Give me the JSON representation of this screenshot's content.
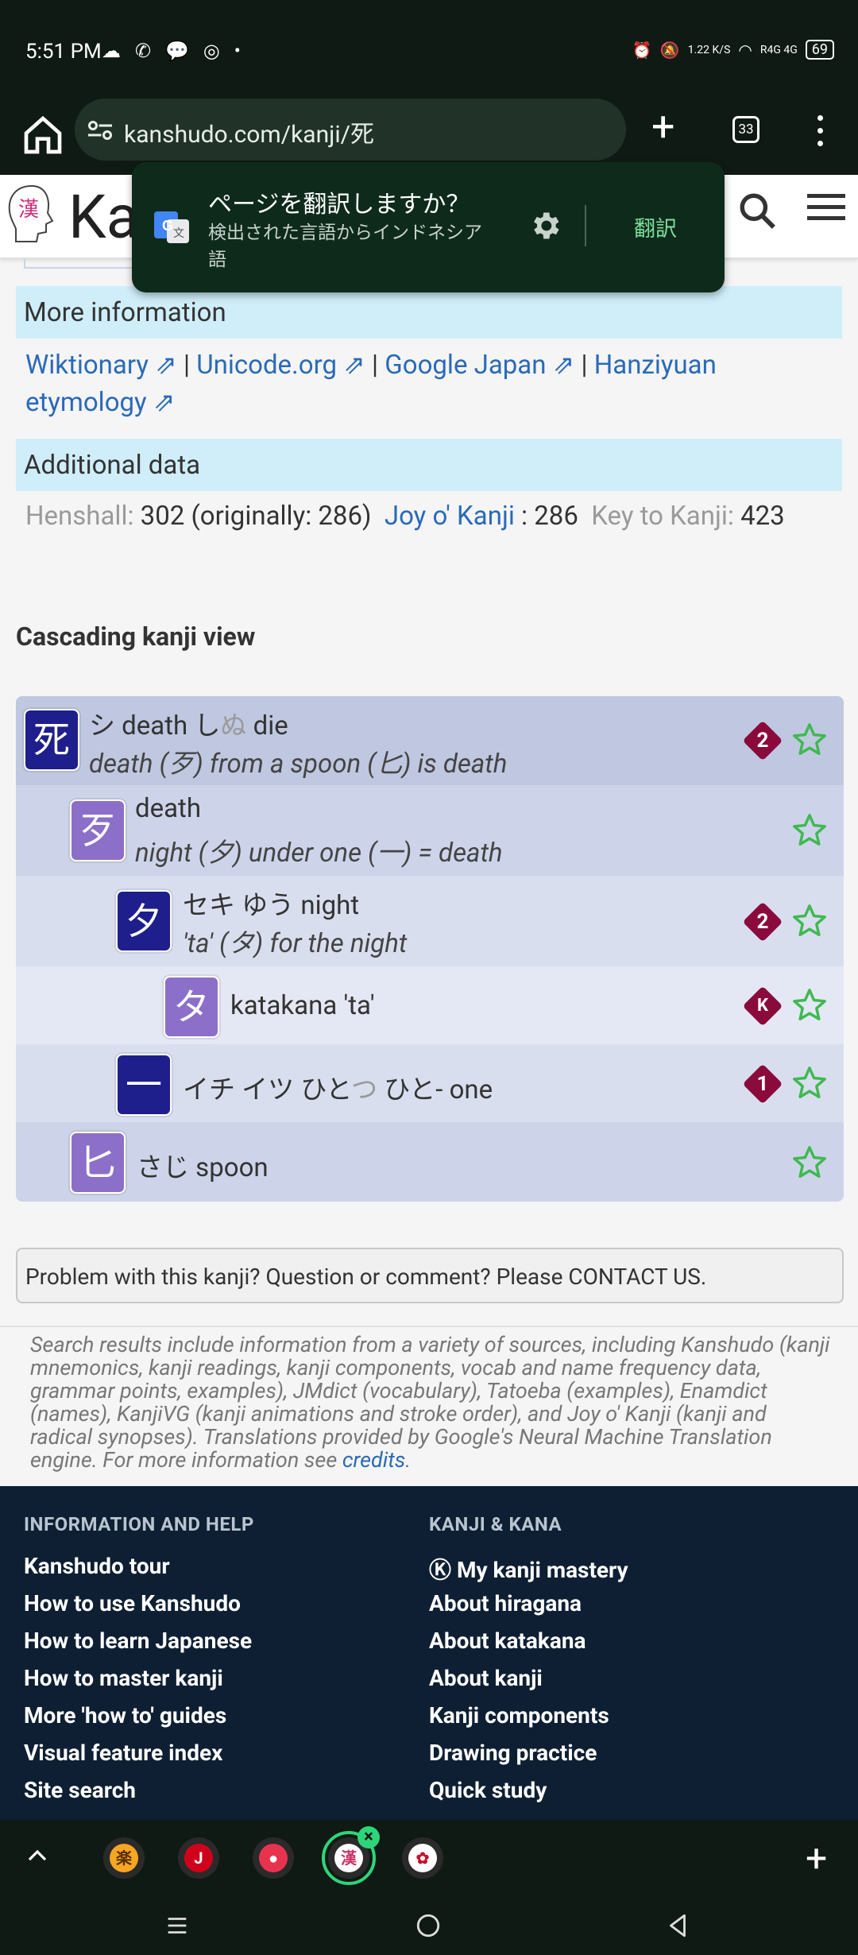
{
  "status_bar": {
    "time": "5:51 PM",
    "notifications": "☁ ✆ 💬 ◎ •",
    "speed": "1.22 K/S",
    "network": "R4G 4G",
    "battery": "69"
  },
  "browser": {
    "url": "kanshudo.com/kanji/死",
    "tab_count": "33"
  },
  "site": {
    "logo_icon_char": "漢",
    "logo_text": "Ka"
  },
  "translate_popup": {
    "title": "ページを翻訳しますか？",
    "subtitle": "検出された言語からインドネシア語",
    "action": "翻訳"
  },
  "more_info": {
    "heading": "More information",
    "links": [
      "Wiktionary ⇗",
      "Unicode.org ⇗",
      "Google Japan ⇗",
      "Hanziyuan etymology ⇗"
    ],
    "separator": " | "
  },
  "additional": {
    "heading": "Additional data",
    "henshall_label": "Henshall:",
    "henshall_value": "302 (originally: 286)",
    "joyo_label": "Joy o' Kanji",
    "joyo_value": ": 286",
    "key_label": "Key to Kanji:",
    "key_value": "423"
  },
  "cascade": {
    "title": "Cascading kanji view",
    "rows": [
      {
        "kanji": "死",
        "line1_a": "シ   death   し",
        "line1_faded": "ぬ",
        "line1_b": " die",
        "line2": "death (歹) from a spoon (匕) is death",
        "badge": "2"
      },
      {
        "kanji": "歹",
        "line1_a": "death",
        "line2": "night (夕) under one (一) = death"
      },
      {
        "kanji": "夕",
        "line1_a": "セキ   ゆう  night",
        "line2": "'ta' (タ) for the night",
        "badge": "2"
      },
      {
        "kanji": "タ",
        "line1_a": "katakana 'ta'",
        "badge": "K"
      },
      {
        "kanji": "一",
        "line1_a": "イチ   イツ   ひと",
        "line1_faded": "つ",
        "line1_b": "   ひと- one",
        "badge": "1"
      },
      {
        "kanji": "匕",
        "line1_a": "さじ spoon"
      }
    ]
  },
  "problem_text": "Problem with this kanji? Question or comment? Please CONTACT US.",
  "sources": {
    "text": "Search results include information from a variety of sources, including Kanshudo (kanji mnemonics, kanji readings, kanji components, vocab and name frequency data, grammar points, examples), JMdict (vocabulary), Tatoeba (examples), Enamdict (names), KanjiVG (kanji animations and stroke order), and Joy o' Kanji (kanji and radical synopses). Translations provided by Google's Neural Machine Translation engine. For more information see ",
    "link": "credits",
    "end": "."
  },
  "footer": {
    "col1": {
      "heading": "INFORMATION AND HELP",
      "items": [
        "Kanshudo tour",
        "How to use Kanshudo",
        "How to learn Japanese",
        "How to master kanji",
        "More 'how to' guides",
        "Visual feature index",
        "Site search"
      ]
    },
    "col2": {
      "heading": "KANJI & KANA",
      "items": [
        "Ⓚ My kanji mastery",
        "About hiragana",
        "About katakana",
        "About kanji",
        "Kanji components",
        "Drawing practice",
        "Quick study"
      ]
    }
  },
  "tab_strip": {
    "tabs": [
      {
        "char": "楽",
        "bg": "#f5a623",
        "fg": "#5a2e00"
      },
      {
        "char": "J",
        "bg": "#d0021b",
        "fg": "#ffffff"
      },
      {
        "char": "●",
        "bg": "#e8334f",
        "fg": "#ffffff"
      },
      {
        "char": "漢",
        "bg": "#ffffff",
        "fg": "#cc3366"
      },
      {
        "char": "✿",
        "bg": "#ffffff",
        "fg": "#c8102e"
      }
    ],
    "close_symbol": "×",
    "plus": "+"
  },
  "colors": {
    "kanji_dark": "#1e1e8c",
    "kanji_purple": "#8c6fc9",
    "badge": "#8a0a3c",
    "star": "#3fb950",
    "link": "#2a6ab8"
  }
}
